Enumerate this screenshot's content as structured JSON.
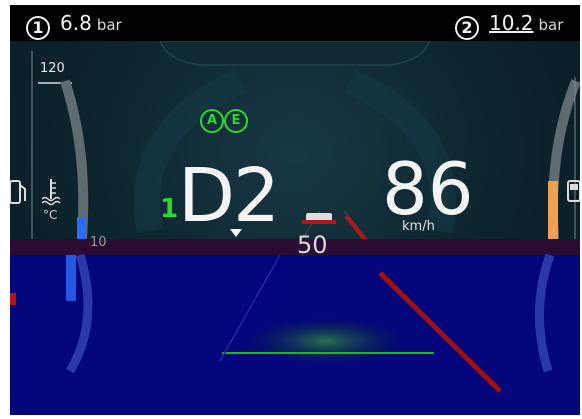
{
  "colors": {
    "top_bar": "#000000",
    "dash_bg": "#0b2028",
    "overlay_blue": "#03057a",
    "accent_green": "#2bd82b",
    "lane_red": "#a01010",
    "gauge_blue": "#2a6bff",
    "gauge_orange": "#f0a050"
  },
  "tyres": {
    "front": {
      "index": "1",
      "value": "6.8",
      "unit": "bar"
    },
    "rear": {
      "index": "2",
      "value": "10.2",
      "unit": "bar"
    }
  },
  "drive": {
    "gear_number": "1",
    "gear": "D2",
    "modes": [
      "A",
      "E"
    ]
  },
  "speed": {
    "value": "86",
    "unit": "km/h",
    "limit": "50"
  },
  "gauge": {
    "max_tick": "120",
    "tick_100": "10",
    "temp_unit": "°C"
  },
  "icons": {
    "fuel_left": "fuel-pump-icon",
    "coolant": "coolant-temp-icon",
    "fuel_right": "fuel-pump-icon",
    "gear_marker": "triangle-down-icon"
  }
}
